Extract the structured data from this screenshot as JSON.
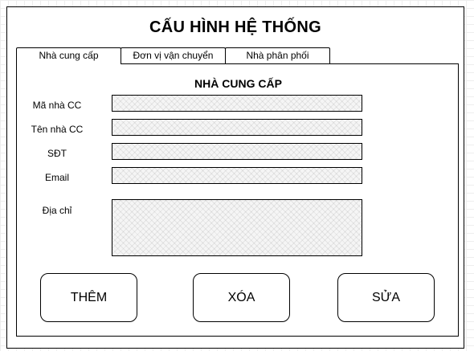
{
  "window": {
    "title": "CẤU HÌNH HỆ THỐNG"
  },
  "tabs": [
    {
      "label": "Nhà cung cấp",
      "active": true
    },
    {
      "label": "Đơn vị vận chuyển",
      "active": false
    },
    {
      "label": "Nhà phân phối",
      "active": false
    }
  ],
  "form": {
    "section_title": "NHÀ CUNG CẤP",
    "fields": [
      {
        "label": "Mã nhà CC",
        "value": ""
      },
      {
        "label": "Tên nhà CC",
        "value": ""
      },
      {
        "label": "SĐT",
        "value": ""
      },
      {
        "label": "Email",
        "value": ""
      },
      {
        "label": "Địa chỉ",
        "value": ""
      }
    ]
  },
  "actions": {
    "add_label": "THÊM",
    "delete_label": "XÓA",
    "edit_label": "SỬA"
  }
}
